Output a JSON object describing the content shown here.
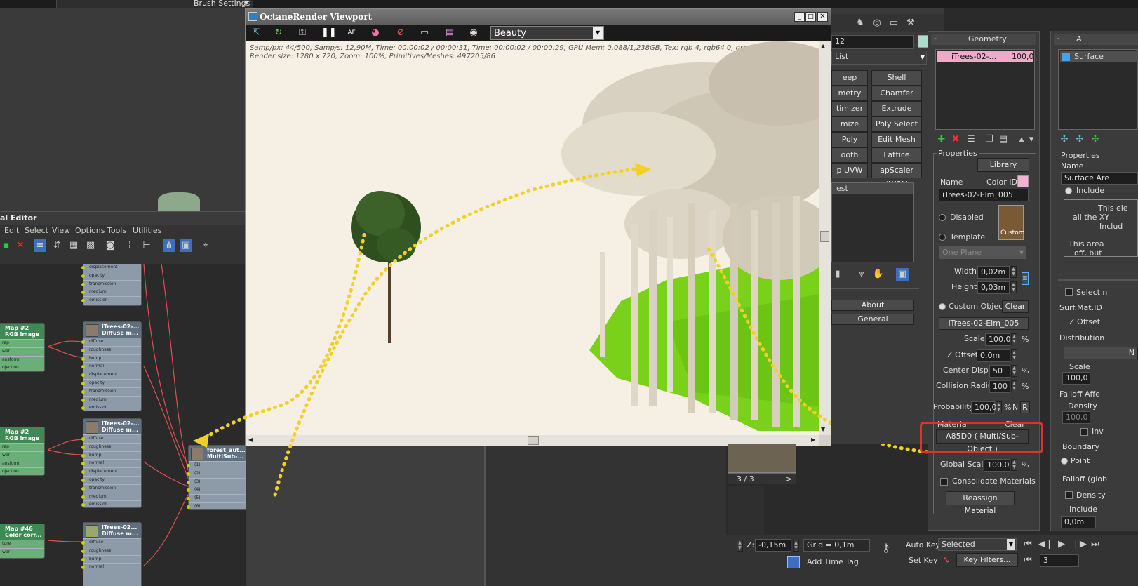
{
  "brush_settings": {
    "label": "Brush Settings"
  },
  "material_editor": {
    "title": "al Editor",
    "menu": [
      "Edit",
      "Select",
      "View",
      "Options",
      "Tools",
      "Utilities"
    ],
    "nodes": {
      "top_slots": [
        "displacement",
        "opacity",
        "transmission",
        "medium",
        "emission"
      ],
      "map2a_title": "Map #2",
      "map2a_sub": "RGB image",
      "map_slots": [
        "rap",
        "wer",
        "ansform",
        "ojection"
      ],
      "itrees_a_title": "iTrees-02-...",
      "itrees_a_sub": "Diffuse m...",
      "diffuse_slots": [
        "diffuse",
        "roughness",
        "bump",
        "normal",
        "displacement",
        "opacity",
        "transmission",
        "medium",
        "emission"
      ],
      "map2b_title": "Map #2",
      "map2b_sub": "RGB image",
      "itrees_b_title": "iTrees-02-...",
      "itrees_b_sub": "Diffuse m...",
      "forest_title": "forest_aut...",
      "forest_sub": "MultiSub-...",
      "forest_slots": [
        "(1)",
        "(2)",
        "(3)",
        "(4)",
        "(5)",
        "(6)"
      ],
      "map46_title": "Map #46",
      "map46_sub": "Color corr...",
      "map46_slots": [
        "ture",
        "wer"
      ],
      "itrees_c_title": "iTrees-02...",
      "itrees_c_sub": "Diffuse m...",
      "itrees_c_slots": [
        "diffuse",
        "roughness",
        "bump",
        "normal"
      ]
    }
  },
  "viewport": {
    "title": "OctaneRender Viewport",
    "pass_select": "Beauty",
    "stats_line1": "Samp/px: 44/500,   Samp/s: 12,90M,   Time: 00:00:02 / 00:00:31,   Time: 00:00:02 / 00:00:29,   GPU Mem: 0,088/1,238GB,   Tex: rgb 4, rgb64 0, grey 0, grey16 0.",
    "stats_line2": "Render size: 1280 x 720,   Zoom: 100%,   Primitives/Meshes: 497205/86"
  },
  "modifier_panel": {
    "field_value": "12",
    "list_label": "List",
    "buttons_left": [
      "eep",
      "metry",
      "timizer",
      "mize",
      "Poly",
      "ooth",
      "p UVW"
    ],
    "buttons_right": [
      "Shell",
      "Chamfer",
      "Extrude",
      "Poly Select",
      "Edit Mesh",
      "Lattice",
      "apScaler (WSM"
    ],
    "stack_label": "est",
    "about": "About",
    "general": "General",
    "thumb_pager": "3 / 3",
    "thumb_next": ">"
  },
  "geometry_panel": {
    "rollout_title": "Geometry",
    "list_item_name": "iTrees-02-...",
    "list_item_value": "100,0",
    "properties_title": "Properties",
    "library_btn": "Library",
    "name_label": "Name",
    "color_id_label": "Color ID",
    "name_value": "iTrees-02-Elm_005",
    "disabled_label": "Disabled",
    "template_label": "Template",
    "custom_thumb_label": "Custom",
    "plane_select": "One Plane",
    "width_label": "Width",
    "width_value": "0,02m",
    "height_label": "Height",
    "height_value": "0,03m",
    "custom_object_label": "Custom Object",
    "clear_label": "Clear",
    "custom_object_value": "iTrees-02-Elm_005",
    "scale_label": "Scale",
    "scale_value": "100,0",
    "z_offset_label": "Z Offset",
    "z_offset_value": "0,0m",
    "center_displ_label": "Center Displ.",
    "center_displ_value": "50",
    "collision_label": "Collision Radius",
    "collision_value": "100",
    "probability_label": "Probability",
    "probability_value": "100,0",
    "pct": "%",
    "n_label": "N",
    "r_label": "R",
    "material_label": "Materia",
    "material_clear": "Clear",
    "material_value": "A85D0  ( Multi/Sub-Object )",
    "global_scale_label": "Global Scale",
    "global_scale_value": "100,0",
    "consolidate_label": "Consolidate Materials",
    "reassign_btn": "Reassign Material"
  },
  "right_panel": {
    "header": "A",
    "surface_label": "Surface",
    "properties": "Properties",
    "name": "Name",
    "name_value": "Surface Are",
    "include": "Include",
    "info1": "This ele",
    "info2": "all the XY",
    "info3": "Includ",
    "info4": "This area",
    "info5": "off, but",
    "select_label": "Select n",
    "surf_mat": "Surf.Mat.ID",
    "z_offset": "Z Offset",
    "distribution": "Distribution",
    "n_btn": "N",
    "scale": "Scale",
    "scale_value": "100,0",
    "falloff_affect": "Falloff Affe",
    "density": "Density",
    "density_value": "100,0",
    "inv": "Inv",
    "boundary": "Boundary",
    "point": "Point",
    "falloff_glob": "Falloff (glob",
    "density2": "Density",
    "include2": "Include",
    "include2_value": "0,0m"
  },
  "status_bar": {
    "z_label": "Z:",
    "z_value": "-0,15m",
    "grid": "Grid = 0,1m",
    "add_time_tag": "Add Time Tag",
    "auto_key": "Auto Key",
    "selected": "Selected",
    "set_key": "Set Key",
    "key_filters": "Key Filters...",
    "frame": "3"
  },
  "colors": {
    "highlight_red": "#e0312b",
    "arrow_yellow": "#f3cf2a",
    "grass_green": "#7ad11a"
  }
}
